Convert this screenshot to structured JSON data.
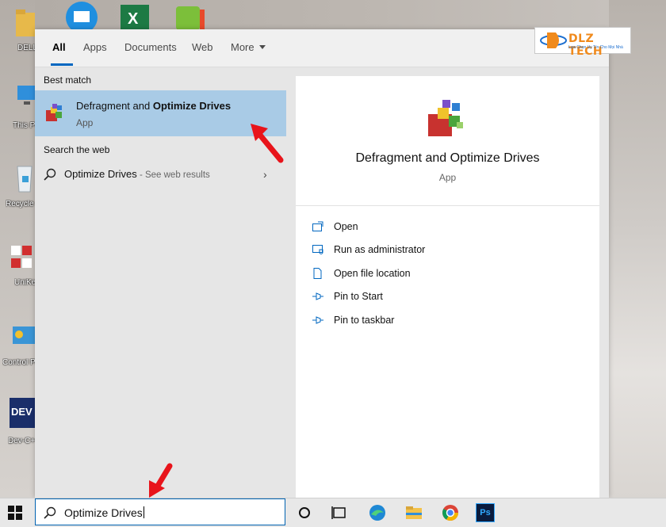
{
  "desktop": {
    "icons": [
      {
        "label": "DELL"
      },
      {
        "label": "This PC"
      },
      {
        "label": "Recycle Bin"
      },
      {
        "label": "UniKey"
      },
      {
        "label": "Control Panel"
      },
      {
        "label": "Dev-C++"
      }
    ]
  },
  "watermark": {
    "brand": "DLZ TECH",
    "tagline": "Lựa Chọn Uy Tín Cho Mọi Nhà"
  },
  "tabs": [
    {
      "label": "All",
      "active": true
    },
    {
      "label": "Apps"
    },
    {
      "label": "Documents"
    },
    {
      "label": "Web"
    },
    {
      "label": "More"
    }
  ],
  "best_match": {
    "section_label": "Best match",
    "title_prefix": "Defragment and ",
    "title_bold": "Optimize Drives",
    "type": "App",
    "highlight_color": "#a9cbe6"
  },
  "search_web": {
    "section_label": "Search the web",
    "query": "Optimize Drives",
    "suffix": " - See web results"
  },
  "detail": {
    "title": "Defragment and Optimize Drives",
    "type": "App",
    "actions": [
      {
        "label": "Open",
        "icon": "open-icon"
      },
      {
        "label": "Run as administrator",
        "icon": "shield-icon"
      },
      {
        "label": "Open file location",
        "icon": "file-location-icon"
      },
      {
        "label": "Pin to Start",
        "icon": "pin-icon"
      },
      {
        "label": "Pin to taskbar",
        "icon": "pin-icon"
      }
    ]
  },
  "taskbar": {
    "search_value": "Optimize Drives",
    "pinned": [
      "cortana-icon",
      "task-view-icon",
      "edge-icon",
      "file-explorer-icon",
      "chrome-icon",
      "photoshop-icon"
    ],
    "photoshop_label": "Ps"
  },
  "accent_color": "#0067c0",
  "annotation_color": "#e8141b"
}
